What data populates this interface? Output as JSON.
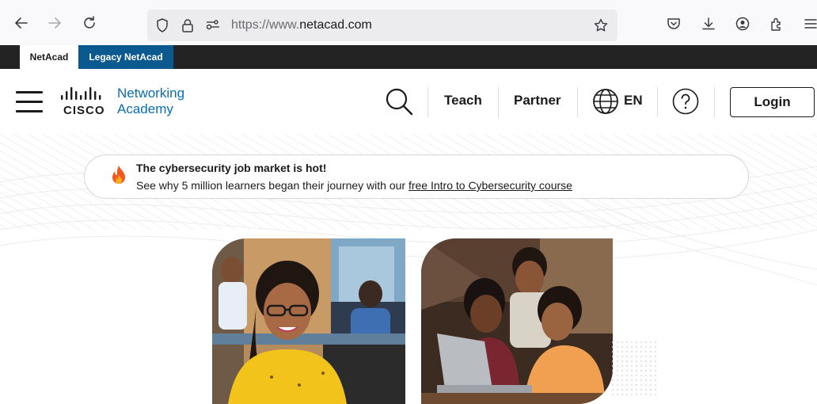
{
  "browser": {
    "url_prefix": "https://www.",
    "url_domain": "netacad.com",
    "icons": [
      "back-icon",
      "forward-icon",
      "reload-icon",
      "shield-icon",
      "lock-icon",
      "permissions-icon",
      "star-icon",
      "pocket-icon",
      "download-icon",
      "account-icon",
      "extensions-icon",
      "menu-icon"
    ]
  },
  "tabs": {
    "netacad": "NetAcad",
    "legacy": "Legacy NetAcad"
  },
  "header": {
    "logo_cisco": "CISCO",
    "logo_line1": "Networking",
    "logo_line2": "Academy",
    "teach": "Teach",
    "partner": "Partner",
    "lang": "EN",
    "login": "Login"
  },
  "banner": {
    "title": "The cybersecurity job market is hot!",
    "body_text": "See why 5 million learners began their journey with our ",
    "link_text": "free Intro to Cybersecurity course"
  },
  "colors": {
    "brand_blue": "#0a6eb2",
    "legacy_tab": "#0b5a8f",
    "tab_strip": "#232323"
  }
}
